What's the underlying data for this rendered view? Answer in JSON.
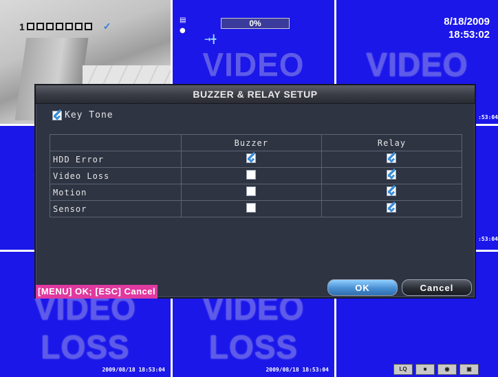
{
  "osd": {
    "date": "8/18/2009",
    "time": "18:53:02",
    "progress": "0%",
    "channel_digit": "1",
    "video_loss_text": "VIDEO LOSS",
    "timestamp": "2009/08/18 18:53:04",
    "edge_time": ":53:04",
    "tray_lq": "LQ"
  },
  "dialog": {
    "title": "BUZZER & RELAY SETUP",
    "keytone_label": "Key Tone",
    "keytone_checked": true,
    "columns": [
      "",
      "Buzzer",
      "Relay"
    ],
    "rows": [
      {
        "label": "HDD Error",
        "buzzer": true,
        "relay": true
      },
      {
        "label": "Video Loss",
        "buzzer": false,
        "relay": true
      },
      {
        "label": "Motion",
        "buzzer": false,
        "relay": true
      },
      {
        "label": "Sensor",
        "buzzer": false,
        "relay": true
      }
    ],
    "hint": "[MENU] OK; [ESC] Cancel",
    "ok_label": "OK",
    "cancel_label": "Cancel"
  },
  "colors": {
    "channel_bg": "#1b17e8",
    "hint_bg": "#e0399f",
    "dialog_bg": "#2e3442",
    "check": "#3d8ed6"
  }
}
